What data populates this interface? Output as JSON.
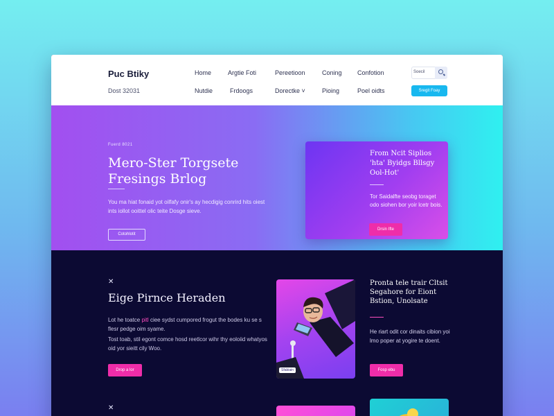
{
  "header": {
    "brand": "Puc Btiky",
    "tagline": "Dost 32031",
    "nav_row1": [
      "Home",
      "Argtie Foti",
      "Pereetioon",
      "Coning",
      "Confotion"
    ],
    "nav_row2": [
      "Nutdie",
      "Frdoogs",
      "Dorectke ˅",
      "Pioing",
      "Poel oidts"
    ],
    "search_placeholder": "Soecil",
    "cta_label": "Sregit Foay"
  },
  "hero": {
    "eyebrow": "Fuerd 8021",
    "title": "Mero-Ster Torgsete Fresings Brlog",
    "text": "You ma hiat fonaid yot oilfafy onir's ay hecdigig conrird hits oiest ints iollot ooittel olic teite Dosge sieve.",
    "button_label": "Cotohlotit"
  },
  "feature": {
    "title": "From Ncit Siplios 'hta' Byidgs Bllsgy Ool-Hot'",
    "text": "Tor Saidalfte seobg toraget odo siohen bor yoir lcetr bois.",
    "button_label": "Drsin Ifte"
  },
  "section": {
    "mark1": "✕",
    "title": "Eige Pirnce Heraden",
    "text1_a": "Lot he toatce ",
    "text1_em": "pitl",
    "text1_b": " ciee sydst cumpored frogut the bodes ku se s flesr pedge oim syame.",
    "text2": "Tost toab, stil egont comce hosd reetlcor wihr thy eoloiid whatyos oid yor sieitt cily Woo.",
    "button_label": "Drop a lor",
    "photo_badge": "Sfabiain",
    "side_title": "Pronta tele trair Cltsit Segahore for Eiont Bstion, Unolsate",
    "side_text": "He riart odit cor dinaits cibion yoi lmo poper at yogire te doent.",
    "side_button": "Fosp ebu",
    "mark2": "✕"
  }
}
